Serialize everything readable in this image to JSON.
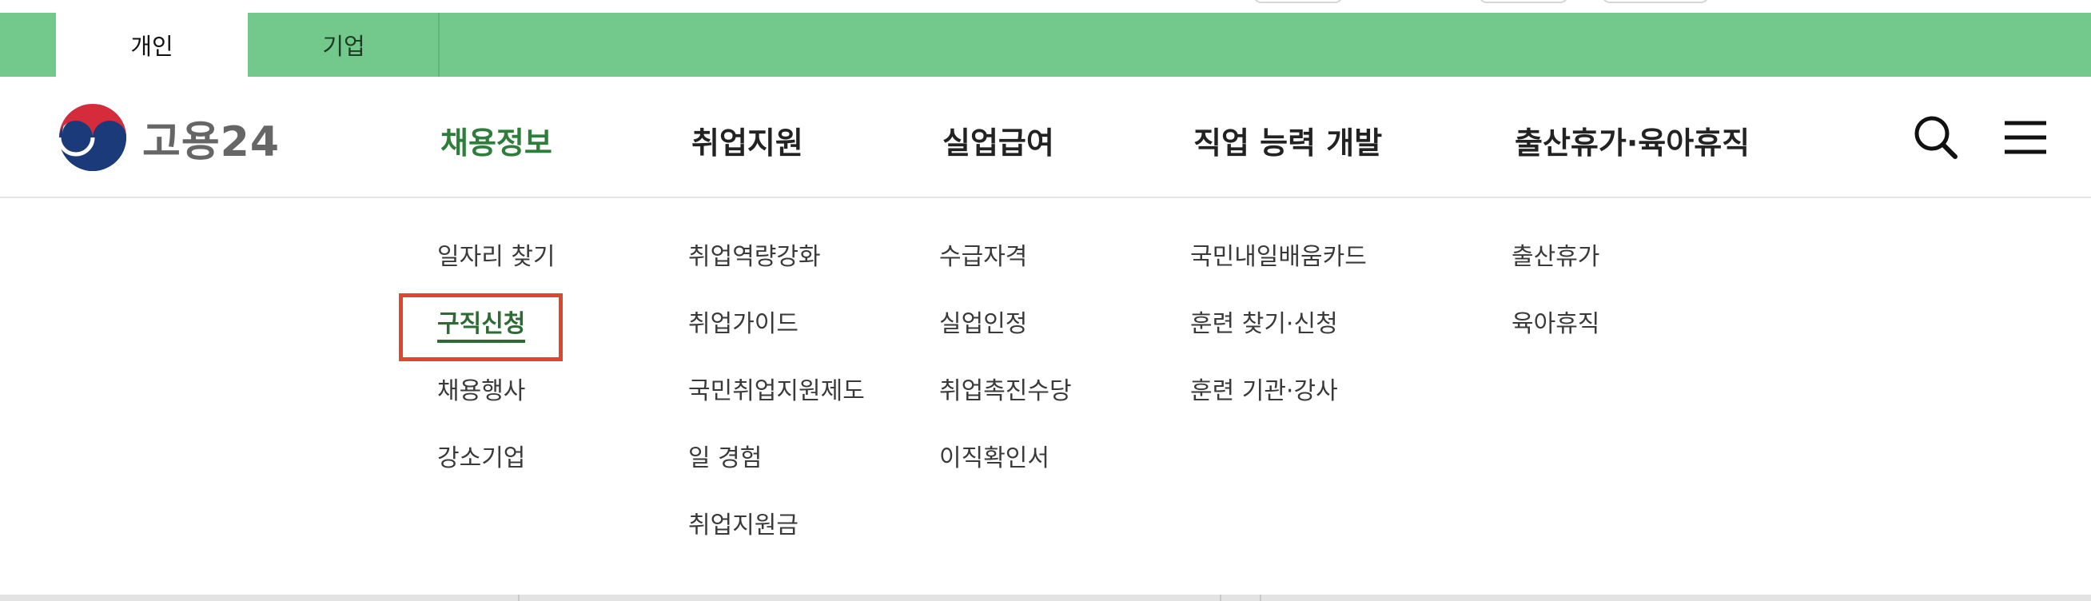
{
  "tabs": [
    {
      "label": "개인",
      "active": true
    },
    {
      "label": "기업",
      "active": false
    }
  ],
  "logo": {
    "text": "고용24",
    "icon": "government-taegeuk-logo-icon"
  },
  "gnb": [
    {
      "label": "채용정보",
      "active": true
    },
    {
      "label": "취업지원",
      "active": false
    },
    {
      "label": "실업급여",
      "active": false
    },
    {
      "label": "직업 능력 개발",
      "active": false
    },
    {
      "label": "출산휴가·육아휴직",
      "active": false
    }
  ],
  "header_icons": {
    "search": "search-icon",
    "menu": "hamburger-menu-icon"
  },
  "menu": {
    "col1": [
      "일자리 찾기",
      "구직신청",
      "채용행사",
      "강소기업"
    ],
    "col2": [
      "취업역량강화",
      "취업가이드",
      "국민취업지원제도",
      "일 경험",
      "취업지원금"
    ],
    "col3": [
      "수급자격",
      "실업인정",
      "취업촉진수당",
      "이직확인서"
    ],
    "col4": [
      "국민내일배움카드",
      "훈련 찾기·신청",
      "훈련 기관·강사"
    ],
    "col5": [
      "출산휴가",
      "육아휴직"
    ]
  },
  "current_item": "구직신청",
  "colors": {
    "tabbar": "#73c98b",
    "accent_green": "#2d7d3b",
    "highlight_red": "#e0452f"
  }
}
